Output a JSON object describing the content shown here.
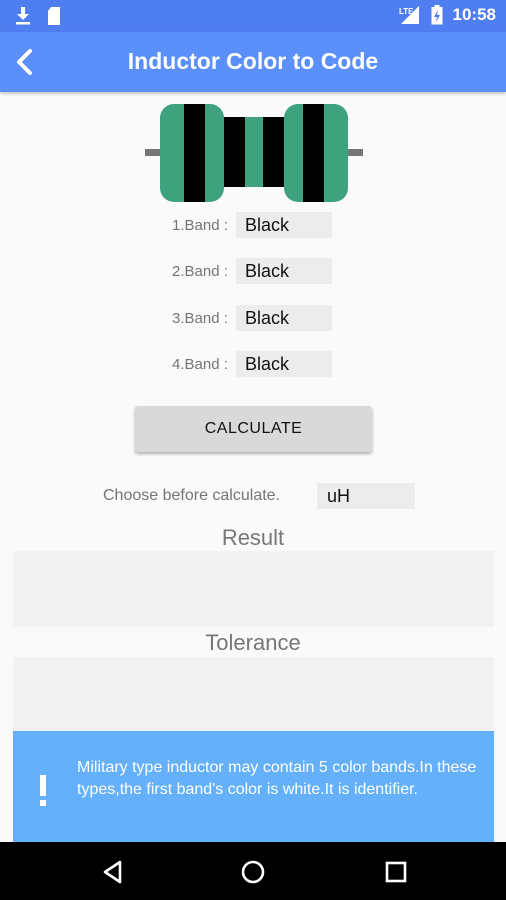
{
  "status_bar": {
    "time": "10:58",
    "network": "LTE",
    "icons": [
      "download-icon",
      "sd-card-icon",
      "signal-icon",
      "battery-icon"
    ]
  },
  "app_bar": {
    "title": "Inductor Color to Code",
    "back_icon": "back-arrow-icon"
  },
  "inductor_image": {
    "body_color": "#3fa27f",
    "band_colors": [
      "#000000",
      "#000000",
      "#000000",
      "#000000"
    ],
    "lead_color": "#777777"
  },
  "bands": [
    {
      "label": "1.Band :",
      "value": "Black"
    },
    {
      "label": "2.Band :",
      "value": "Black"
    },
    {
      "label": "3.Band :",
      "value": "Black"
    },
    {
      "label": "4.Band :",
      "value": "Black"
    }
  ],
  "calculate_button": {
    "label": "CALCULATE"
  },
  "unit": {
    "label": "Choose before calculate.",
    "value": "uH"
  },
  "result": {
    "title": "Result",
    "value": ""
  },
  "tolerance": {
    "title": "Tolerance",
    "value": ""
  },
  "info": {
    "icon": "exclamation-icon",
    "text": "Military type inductor may contain 5 color bands.In these types,the first band's color is white.It is identifier."
  },
  "nav_bar": {
    "icons": [
      "back-triangle-icon",
      "home-circle-icon",
      "recents-square-icon"
    ]
  },
  "colors": {
    "status_bar": "#4f7ef0",
    "app_bar": "#5b8ff9",
    "info_banner": "#64b0fa",
    "button": "#d9d9d9"
  }
}
